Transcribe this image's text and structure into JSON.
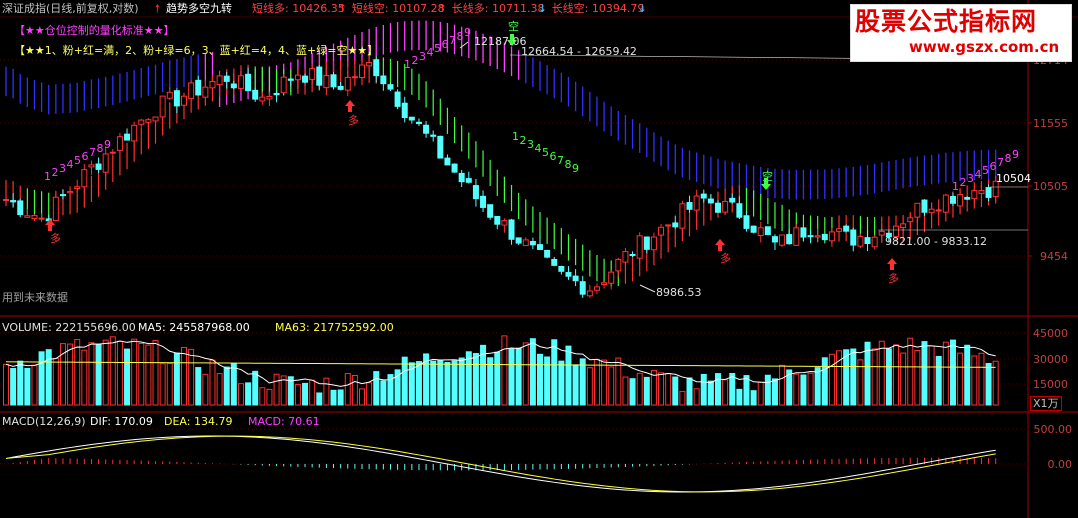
{
  "header": {
    "index_name": "深证成指(日线,前复权,对数)",
    "indicator_name": "趋势多空九转",
    "values": [
      {
        "label": "短线多: 10426.35",
        "arrow": "↑",
        "color": "#ff4040"
      },
      {
        "label": "短线空: 10107.28",
        "arrow": "↑",
        "color": "#ff4040"
      },
      {
        "label": "长线多: 10711.38",
        "arrow": "↓",
        "color": "#ff4040"
      },
      {
        "label": "长线空: 10394.79",
        "arrow": "↓",
        "color": "#ff4040"
      }
    ]
  },
  "notes": {
    "title": "【★★仓位控制的量化标准★★】",
    "rule": "【★★1、粉+红=满，2、粉+绿=6，3、蓝+红=4，4、蓝+绿=空★★】",
    "future_data": "用到未来数据"
  },
  "price_labels": {
    "high_label": "12187.06",
    "range_label": "12664.54 - 12659.42",
    "low_label": "8986.53",
    "mid_label": "9821.00 - 9833.12",
    "last_label": "10504"
  },
  "signals": {
    "buy": "多",
    "sell": "空"
  },
  "volume_header": {
    "volume": "VOLUME: 222155696.00",
    "ma5": "MA5: 245587968.00",
    "ma63": "MA63: 217752592.00"
  },
  "macd_header": {
    "name": "MACD(12,26,9)",
    "dif": "DIF: 170.09",
    "dea": "DEA: 134.79",
    "macd": "MACD: 70.61"
  },
  "unit_label": "X1万",
  "watermark": {
    "title": "股票公式指标网",
    "url": "www.gszx.com.cn"
  },
  "chart_data": [
    {
      "type": "candlestick",
      "panel": "price",
      "y_axis_ticks": [
        12714,
        11555,
        10505,
        9454
      ],
      "y_scale": "log",
      "approx_close_path": [
        10300,
        10000,
        10600,
        11200,
        11800,
        12100,
        12400,
        12000,
        12500,
        12200,
        12650,
        11700,
        10900,
        10200,
        9700,
        9200,
        9000,
        9500,
        9900,
        10300,
        10100,
        9600,
        9900,
        9700,
        9830,
        10200,
        10400,
        10504
      ]
    },
    {
      "type": "bar",
      "panel": "volume",
      "y_axis_ticks": [
        45000,
        30000,
        15000
      ],
      "unit": "X1万"
    },
    {
      "type": "bar",
      "panel": "macd",
      "y_axis_ticks": [
        500.0,
        0.0
      ]
    }
  ]
}
